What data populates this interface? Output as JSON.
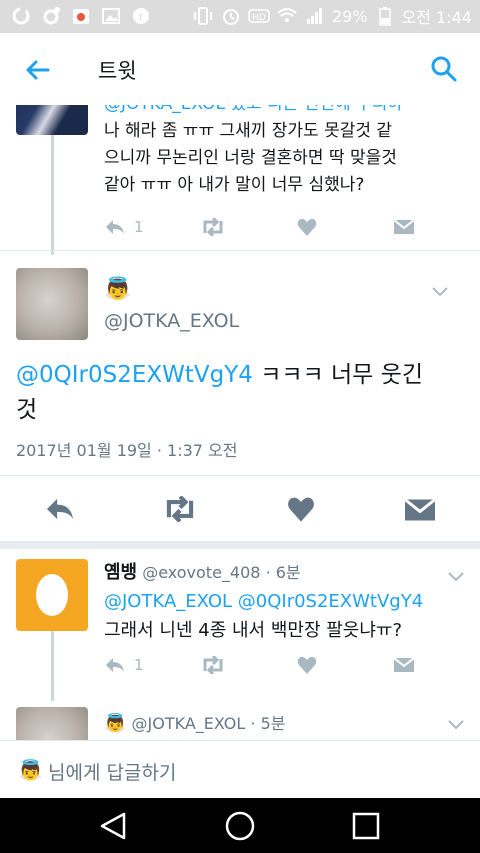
{
  "status_bar": {
    "battery": "29%",
    "time": "오전 1:44"
  },
  "header": {
    "title": "트윗"
  },
  "prev_tweet": {
    "lines": [
      "@JOTKA_EXOL 했고 니는 전번에 우리하",
      "나 해라  좀 ㅠㅠ 그새끼 장가도 못갈것 같",
      "으니까 무논리인 너랑 결혼하면 딱 맞을것",
      "같아 ㅠㅠ 아 내가 말이 너무 심했나?"
    ],
    "reply_count": "1"
  },
  "main_tweet": {
    "emoji": "👼",
    "handle": "@JOTKA_EXOL",
    "mention": "@0QIr0S2EXWtVgY4",
    "text_after_mention": " ㅋㅋㅋ 너무 웃긴",
    "text_line2": "것",
    "timestamp": "2017년 01월 19일 · 1:37 오전"
  },
  "reply_tweet": {
    "name": "옘뱅",
    "handle": "@exovote_408",
    "time": "· 6분",
    "mention1": "@JOTKA_EXOL",
    "mention2": "@0QIr0S2EXWtVgY4",
    "text": "그래서 니넨 4종 내서 백만장 팔읏냐ㅠ?",
    "reply_count": "1"
  },
  "next_tweet": {
    "emoji": "👼",
    "handle": "@JOTKA_EXOL",
    "time": "· 5분"
  },
  "reply_bar": {
    "emoji": "👼",
    "placeholder": "님에게 답글하기"
  },
  "colors": {
    "accent": "#1da1f2",
    "egg_bg": "#f5a623",
    "icon_grey": "#aab8c2",
    "icon_dark": "#657786"
  }
}
